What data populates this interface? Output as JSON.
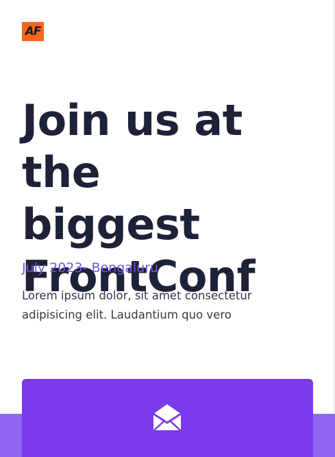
{
  "brand": {
    "logo_text": "AF"
  },
  "hero": {
    "title_lines": [
      "Join us at the",
      "biggest",
      "FrontConf"
    ],
    "event_info": "July 2023- Bengaluru",
    "description": "Lorem ipsum dolor, sit amet consectetur adipisicing elit. Laudantium quo vero"
  },
  "card": {
    "icon": "envelope-open-icon"
  },
  "colors": {
    "heading": "#1d2238",
    "accent_text": "#6d58e0",
    "logo_bg": "#f7661e",
    "card_bg": "#7c3aed",
    "band_bg": "#8f66f2"
  }
}
